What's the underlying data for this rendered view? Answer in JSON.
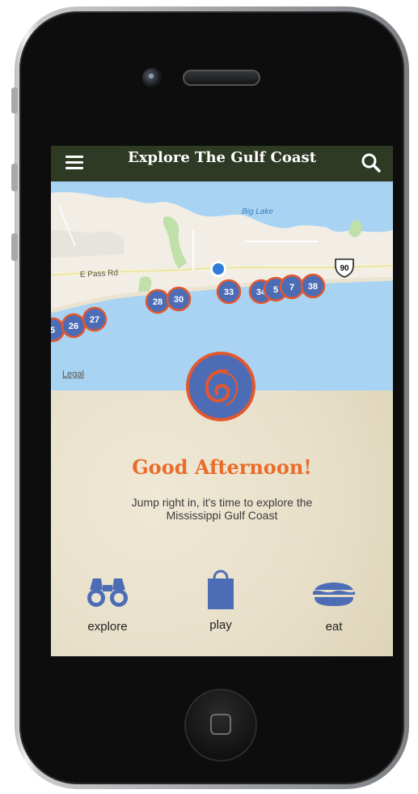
{
  "header": {
    "title": "Explore The Gulf Coast"
  },
  "map": {
    "legal_label": "Legal",
    "labels": {
      "lake": "Big Lake",
      "road": "E Pass Rd",
      "highway": "90"
    },
    "clusters": [
      {
        "label": "5"
      },
      {
        "label": "26"
      },
      {
        "label": "27"
      },
      {
        "label": "28"
      },
      {
        "label": "30"
      },
      {
        "label": "33"
      },
      {
        "label": "34"
      },
      {
        "label": "5"
      },
      {
        "label": "7"
      },
      {
        "label": "38"
      }
    ],
    "colors": {
      "water": "#a9d3f2",
      "land": "#f2eee6",
      "cluster": "#4c6db6",
      "cluster_ring": "#e4572e"
    }
  },
  "main": {
    "greeting": "Good Afternoon!",
    "subtitle_line1": "Jump right in, it's time to explore the",
    "subtitle_line2": "Mississippi Gulf Coast"
  },
  "nav": {
    "items": [
      {
        "label": "explore",
        "icon": "binoculars-icon"
      },
      {
        "label": "play",
        "icon": "shopping-bag-icon"
      },
      {
        "label": "eat",
        "icon": "sandwich-icon"
      }
    ]
  },
  "colors": {
    "header_bg": "#2f3a24",
    "accent": "#ea6c2a",
    "icon_blue": "#4c6db6"
  }
}
